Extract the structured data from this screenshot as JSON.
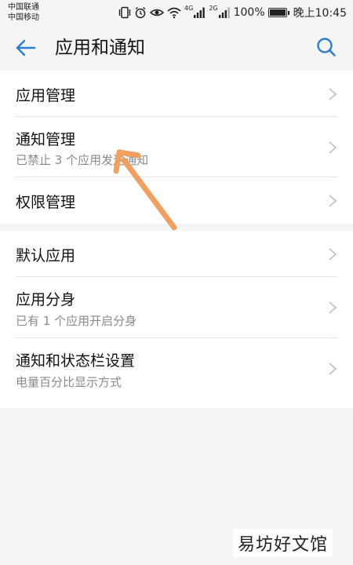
{
  "status_bar": {
    "carrier_1": "中国联通",
    "carrier_2": "中国移动",
    "battery": "100%",
    "time": "晚上10:45",
    "network_1": "4G",
    "network_2": "2G",
    "icons": [
      "vibrate-icon",
      "alarm-icon",
      "eye-icon",
      "wifi-icon",
      "signal-icon",
      "signal-icon",
      "battery-icon"
    ]
  },
  "app_bar": {
    "title": "应用和通知",
    "back_icon": "arrow-left-icon",
    "search_icon": "search-icon"
  },
  "settings": {
    "group_1": [
      {
        "title": "应用管理"
      },
      {
        "title": "通知管理",
        "subtitle": "已禁止 3 个应用发送通知"
      },
      {
        "title": "权限管理"
      }
    ],
    "group_2": [
      {
        "title": "默认应用"
      },
      {
        "title": "应用分身",
        "subtitle": "已有 1 个应用开启分身"
      },
      {
        "title": "通知和状态栏设置",
        "subtitle": "电量百分比显示方式"
      }
    ]
  },
  "annotation": {
    "color": "#f0a060"
  },
  "watermark": "易坊好文馆",
  "colors": {
    "accent": "#2a7fd1",
    "subtitle": "#8a8a8a",
    "background": "#f5f5f5"
  }
}
